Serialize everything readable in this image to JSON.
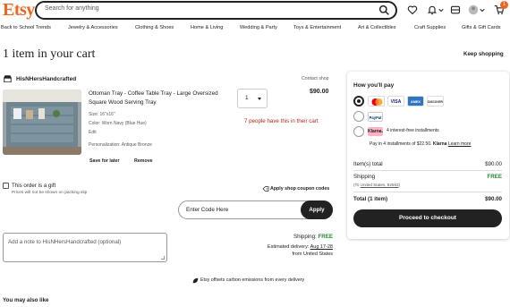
{
  "header": {
    "logo": "Etsy",
    "search_placeholder": "Search for anything",
    "cart_count": "1"
  },
  "nav": {
    "items": [
      "Back to School Trends",
      "Jewelry & Accessories",
      "Clothing & Shoes",
      "Home & Living",
      "Wedding & Party",
      "Toys & Entertainment",
      "Art & Collectibles",
      "Craft Supplies",
      "Gifts & Gift Cards"
    ]
  },
  "cart": {
    "title": "1 item in your cart",
    "keep_shopping": "Keep shopping"
  },
  "shop": {
    "name": "HisNHersHandcrafted",
    "contact": "Contact shop"
  },
  "item": {
    "title": "Ottoman Tray - Coffee Table Tray - Large Oversized Square Wood Serving Tray",
    "size": "Size: 16\"x16\"",
    "color": "Color: Worn Navy (Blue Hue)",
    "edit": "Edit",
    "personalization": "Personalization: Antique Bronze",
    "save_for_later": "Save for later",
    "remove": "Remove",
    "quantity": "1",
    "price": "$90.00",
    "demand": "7 people have this in their cart"
  },
  "gift": {
    "label": "This order is a gift",
    "note": "Prices will not be shown on packing slip"
  },
  "coupon": {
    "label": "Apply shop coupon codes",
    "placeholder": "Enter Code Here",
    "apply": "Apply"
  },
  "note": {
    "placeholder": "Add a note to HisNHersHandcrafted (optional)"
  },
  "shipping": {
    "label": "Shipping:",
    "value": "FREE",
    "delivery_label": "Estimated delivery:",
    "delivery_date": "Aug 17-28",
    "from": "from United States"
  },
  "carbon": "Etsy offsets carbon emissions from every delivery",
  "also_like": "You may also like",
  "pay": {
    "heading": "How you'll pay",
    "cards": [
      "VISA",
      "AMEX",
      "DISCOVER"
    ],
    "paypal": "PayPal",
    "klarna_logo": "Klarna.",
    "klarna_text": "4 interest-free installments",
    "klarna_detail_prefix": "Pay in 4 installments of $22.50.",
    "klarna_brand": "Klarna",
    "learn_more": "Learn more"
  },
  "summary": {
    "items_total_label": "Item(s) total",
    "items_total": "$90.00",
    "shipping_label": "Shipping",
    "shipping_value": "FREE",
    "shipping_to_prefix": "(To",
    "shipping_to": "United States, 92563",
    "shipping_to_suffix": ")",
    "total_label": "Total (1 item)",
    "total": "$90.00",
    "checkout": "Proceed to checkout"
  },
  "colors": {
    "brand": "#f1641e",
    "free": "#258635",
    "demand": "#b02a1a"
  }
}
